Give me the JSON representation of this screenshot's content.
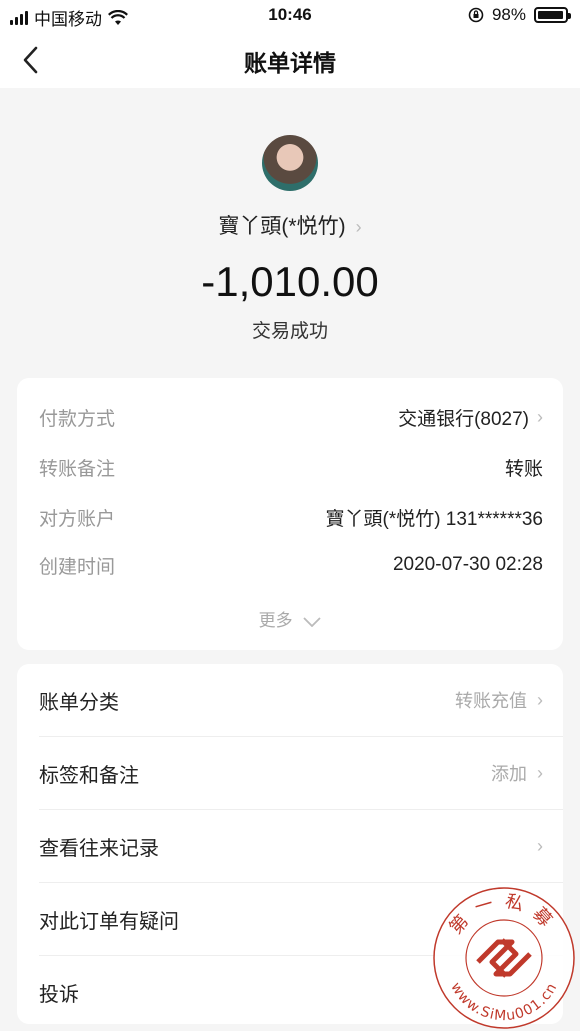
{
  "status_bar": {
    "carrier": "中国移动",
    "time": "10:46",
    "battery_percent": "98%",
    "battery_level": 0.98
  },
  "nav": {
    "title": "账单详情"
  },
  "header": {
    "name": "寶丫頭(*悦竹)",
    "amount": "-1,010.00",
    "status": "交易成功"
  },
  "details": {
    "rows": [
      {
        "label": "付款方式",
        "value": "交通银行(8027)",
        "has_chevron": true
      },
      {
        "label": "转账备注",
        "value": "转账",
        "has_chevron": false
      },
      {
        "label": "对方账户",
        "value": "寶丫頭(*悦竹) 131******36",
        "has_chevron": false
      },
      {
        "label": "创建时间",
        "value": "2020-07-30 02:28",
        "has_chevron": false
      }
    ],
    "more_label": "更多"
  },
  "actions": {
    "rows": [
      {
        "label": "账单分类",
        "value": "转账充值"
      },
      {
        "label": "标签和备注",
        "value": "添加"
      },
      {
        "label": "查看往来记录",
        "value": ""
      },
      {
        "label": "对此订单有疑问",
        "value": ""
      },
      {
        "label": "投诉",
        "value": ""
      }
    ]
  },
  "watermark": {
    "top_text": "第一私募",
    "bottom_text": "www.SiMu001.cn"
  },
  "colors": {
    "accent_watermark": "#c0392b",
    "background": "#f5f5f5"
  }
}
